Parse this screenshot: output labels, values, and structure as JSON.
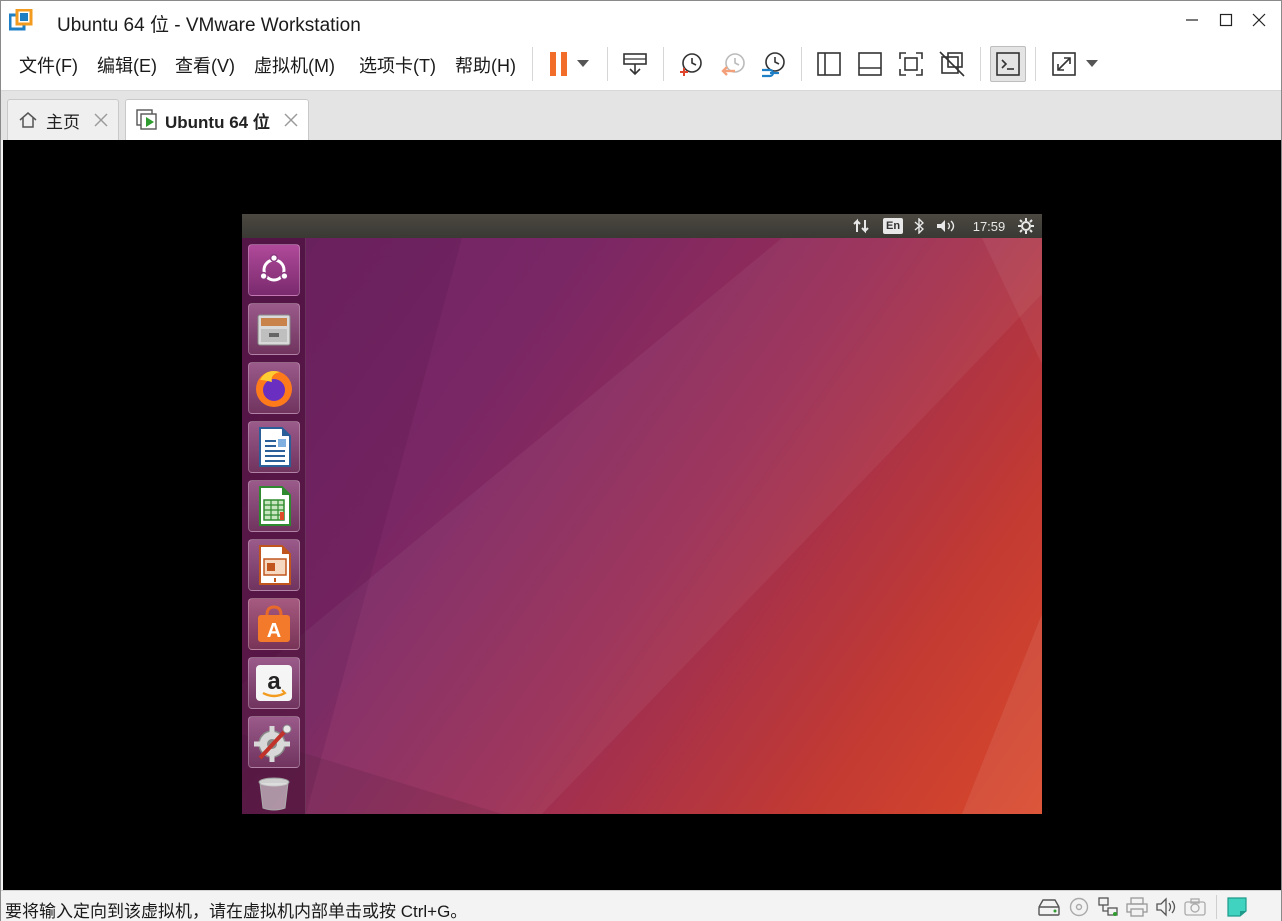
{
  "window": {
    "title": "Ubuntu 64 位 - VMware Workstation"
  },
  "menu": {
    "items": [
      "文件(F)",
      "编辑(E)",
      "查看(V)",
      "虚拟机(M)",
      "选项卡(T)",
      "帮助(H)"
    ]
  },
  "tabs": [
    {
      "label": "主页",
      "icon": "home-icon",
      "active": false
    },
    {
      "label": "Ubuntu 64 位",
      "icon": "vm-running-icon",
      "active": true
    }
  ],
  "guest": {
    "topbar": {
      "lang": "En",
      "time": "17:59"
    },
    "launcher": [
      "ubuntu-dash-icon",
      "files-icon",
      "firefox-icon",
      "libreoffice-writer-icon",
      "libreoffice-calc-icon",
      "libreoffice-impress-icon",
      "software-center-icon",
      "amazon-icon",
      "system-settings-icon",
      "trash-icon"
    ]
  },
  "status": {
    "message": "要将输入定向到该虚拟机，请在虚拟机内部单击或按 Ctrl+G。"
  },
  "colors": {
    "accent_orange": "#f26c2a",
    "toolbar_blue": "#1f7fc4",
    "vm_background": "#000000"
  }
}
